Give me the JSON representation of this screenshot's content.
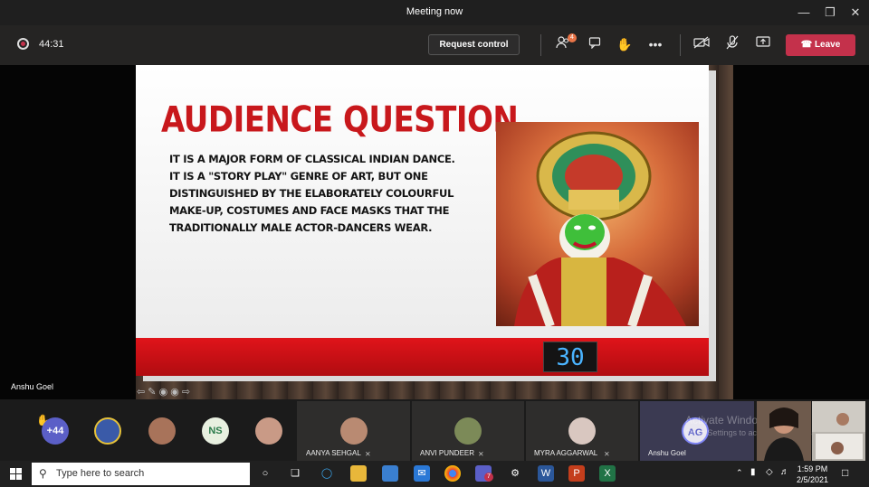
{
  "window": {
    "title": "Meeting now"
  },
  "toolbar": {
    "elapsed": "44:31",
    "request_control": "Request control",
    "participants_badge": "4",
    "leave_label": "Leave"
  },
  "slide": {
    "title": "AUDIENCE QUESTION",
    "body": "IT IS A MAJOR FORM OF CLASSICAL INDIAN DANCE. IT IS A \"STORY PLAY\" GENRE OF ART, BUT ONE DISTINGUISHED BY THE ELABORATELY COLOURFUL MAKE-UP, COSTUMES AND FACE MASKS THAT THE TRADITIONALLY MALE ACTOR-DANCERS WEAR.",
    "countdown": "30"
  },
  "presenter": {
    "name": "Anshu Goel"
  },
  "participants": {
    "more_count": "+44",
    "initials_ns": "NS",
    "tiles": [
      {
        "name": "AANYA SEHGAL"
      },
      {
        "name": "ANVI PUNDEER"
      },
      {
        "name": "MYRA AGGARWAL"
      },
      {
        "name": "Anshu Goel",
        "initials": "AG"
      }
    ]
  },
  "watermark": {
    "line1": "Activate Windows",
    "line2": "Go to Settings to activate Windows."
  },
  "taskbar": {
    "search_placeholder": "Type here to search",
    "teams_badge": "7",
    "time": "1:59 PM",
    "date": "2/5/2021"
  },
  "colors": {
    "leave": "#c4314b",
    "slide_title": "#c8181c",
    "counter_digits": "#4ab4ff"
  }
}
